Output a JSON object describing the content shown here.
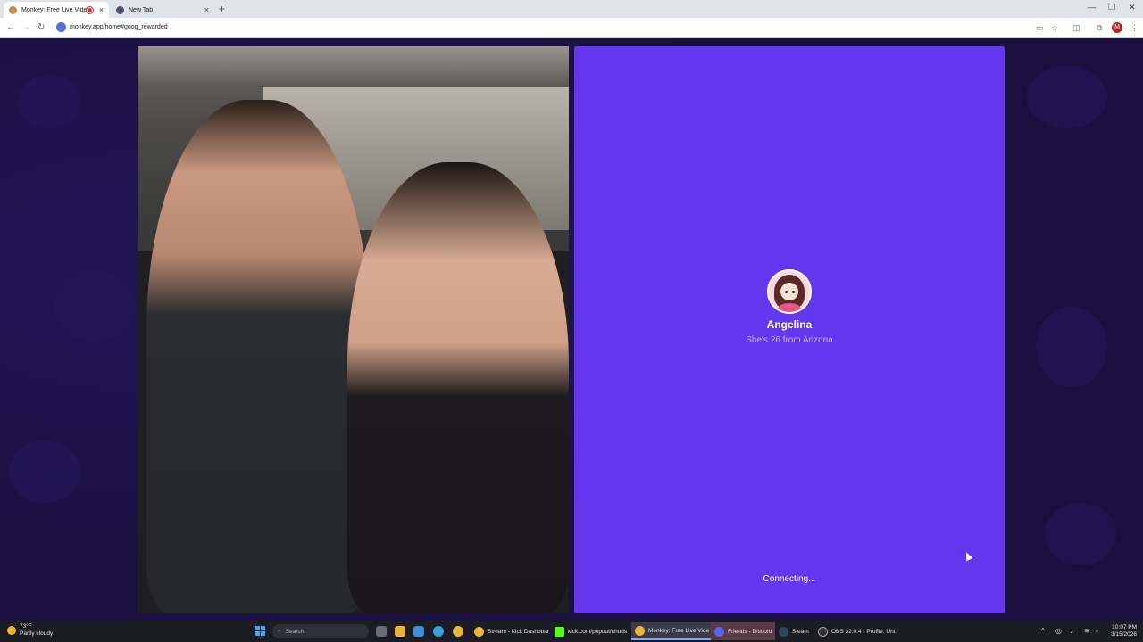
{
  "browser": {
    "tabs": [
      {
        "title": "Monkey: Free Live Video Ch",
        "active": true,
        "recording": true
      },
      {
        "title": "New Tab",
        "active": false
      }
    ],
    "url": "monkey.app/home#goog_rewarded",
    "profile_initial": "M"
  },
  "app": {
    "remote": {
      "name": "Angelina",
      "subtitle": "She's 26 from Arizona",
      "status": "Connecting..."
    },
    "colors": {
      "panel": "#6237ee",
      "background": "#1a1040"
    }
  },
  "taskbar": {
    "weather": {
      "temp": "73°F",
      "condition": "Partly cloudy"
    },
    "search_placeholder": "Search",
    "items": [
      {
        "label": "Stream - Kick Dashboar",
        "icon": "chrome-icon"
      },
      {
        "label": "kick.com/popout/chuds",
        "icon": "kick-icon"
      },
      {
        "label": "Monkey: Free Live Vide",
        "icon": "chrome-icon"
      },
      {
        "label": "Friends - Discord",
        "icon": "discord-icon"
      },
      {
        "label": "Steam",
        "icon": "steam-icon"
      },
      {
        "label": "OBS 32.0.4 - Profile: Unt",
        "icon": "obs-icon"
      }
    ],
    "clock": {
      "time": "10:07 PM",
      "date": "3/15/2026"
    }
  }
}
